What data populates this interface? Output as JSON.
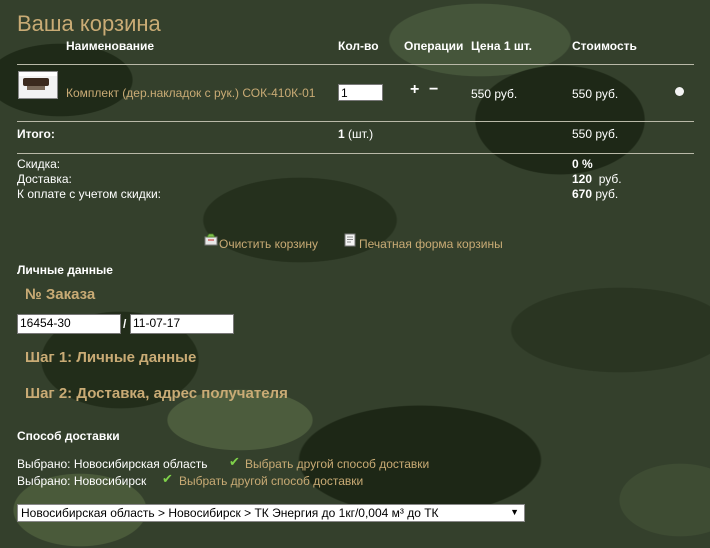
{
  "cart": {
    "title": "Ваша корзина",
    "columns": {
      "name": "Наименование",
      "qty": "Кол-во",
      "ops": "Операции",
      "unit_price": "Цена 1 шт.",
      "cost": "Стоимость"
    },
    "item": {
      "name": "Комплект (дер.накладок с рук.) СОК-410К-01",
      "qty": "1",
      "plus": "+",
      "minus": "−",
      "unit_price": "550 руб.",
      "cost": "550 руб."
    },
    "total": {
      "label": "Итого:",
      "qty_number": "1",
      "qty_unit": "(шт.)",
      "cost": "550 руб."
    },
    "summary": {
      "discount_label": "Скидка:",
      "discount_value": "0 %",
      "delivery_label": "Доставка:",
      "delivery_value": "120",
      "delivery_unit": "руб.",
      "pay_label": "К оплате с учетом скидки:",
      "pay_value": "670",
      "pay_unit": "руб."
    },
    "actions": {
      "clear": "Очистить корзину",
      "print": "Печатная форма корзины"
    }
  },
  "personal": {
    "heading": "Личные данные",
    "order_heading": "№ Заказа",
    "order_number": "16454-30",
    "order_sep": "/",
    "order_date": "11-07-17",
    "step1": "Шаг 1: Личные данные",
    "step2": "Шаг 2: Доставка, адрес получателя"
  },
  "delivery": {
    "heading": "Способ доставки",
    "line1_label": "Выбрано: Новосибирская область",
    "line2_label": "Выбрано: Новосибирск",
    "change_link": "Выбрать другой способ доставки",
    "check_glyph": "✔",
    "select_value": "Новосибирская область > Новосибирск > ТК Энергия до 1кг/0,004 м³ до ТК"
  },
  "colors": {
    "accent_gold": "#c9ab75",
    "check_green": "#7fd24a"
  }
}
